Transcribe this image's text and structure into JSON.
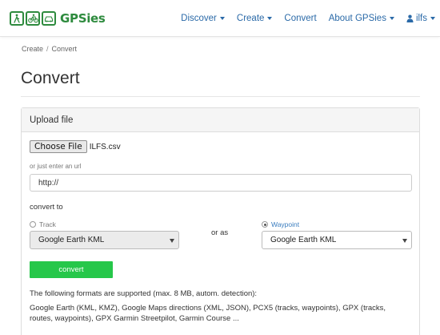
{
  "brand": {
    "name": "GPSies",
    "color": "#2e8b3e"
  },
  "nav": {
    "items": [
      {
        "label": "Discover",
        "dropdown": true
      },
      {
        "label": "Create",
        "dropdown": true
      },
      {
        "label": "Convert",
        "dropdown": false
      },
      {
        "label": "About GPSies",
        "dropdown": true
      }
    ],
    "user": {
      "label": "ilfs",
      "icon": "user-icon"
    },
    "link_color": "#2b6aa8"
  },
  "breadcrumb": {
    "items": [
      "Create",
      "Convert"
    ],
    "separator": "/"
  },
  "page": {
    "title": "Convert"
  },
  "upload": {
    "heading": "Upload file",
    "file_button": "Choose File",
    "file_name": "ILFS.csv",
    "url_hint": "or just enter an url",
    "url_value": "http://"
  },
  "convert": {
    "label": "convert to",
    "track": {
      "label": "Track",
      "selected": false,
      "select_value": "Google Earth KML",
      "enabled": false
    },
    "or_as": "or as",
    "waypoint": {
      "label": "Waypoint",
      "selected": true,
      "select_value": "Google Earth KML",
      "enabled": true
    },
    "button": "convert",
    "button_color": "#26c74a"
  },
  "formats": {
    "intro": "The following formats are supported (max. 8 MB, autom. detection):",
    "list": "Google Earth (KML, KMZ), Google Maps directions (XML, JSON), PCX5 (tracks, waypoints), GPX (tracks, routes, waypoints), GPX Garmin Streetpilot, Garmin Course ..."
  }
}
